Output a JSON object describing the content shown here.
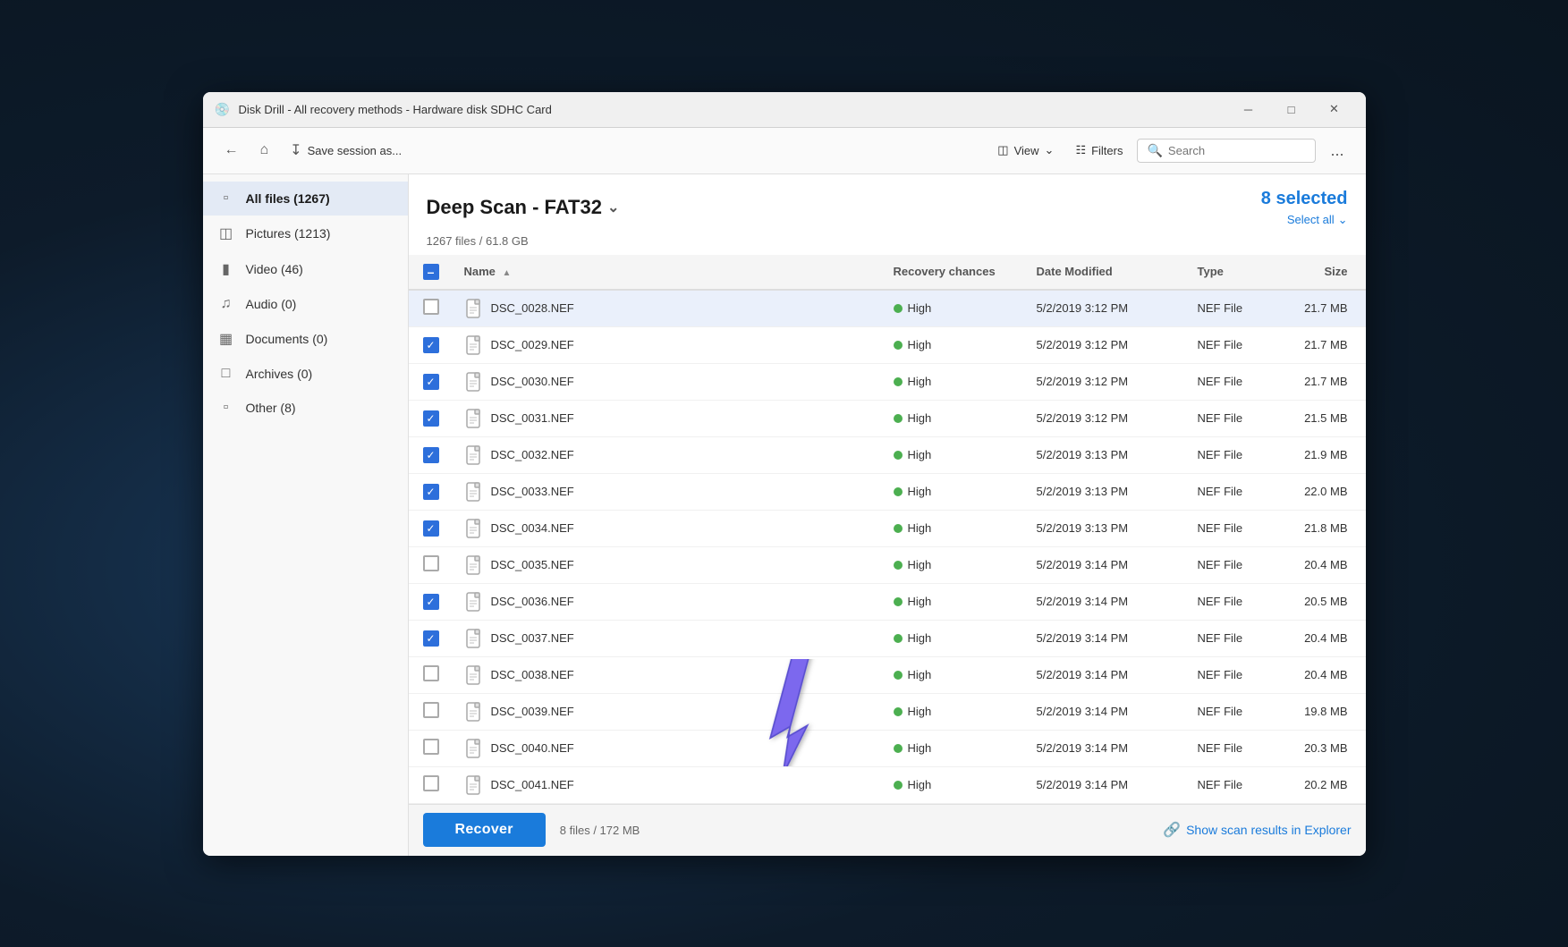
{
  "window": {
    "title": "Disk Drill - All recovery methods - Hardware disk SDHC Card",
    "icon": "💿",
    "controls": {
      "minimize": "─",
      "maximize": "□",
      "close": "✕"
    }
  },
  "toolbar": {
    "back_label": "←",
    "home_label": "⌂",
    "save_label": "💾",
    "save_session_label": "Save session as...",
    "view_label": "View",
    "filters_label": "Filters",
    "search_placeholder": "Search",
    "more_label": "..."
  },
  "sidebar": {
    "items": [
      {
        "id": "all-files",
        "label": "All files (1267)",
        "icon": "▭",
        "active": true
      },
      {
        "id": "pictures",
        "label": "Pictures (1213)",
        "icon": "🖼"
      },
      {
        "id": "video",
        "label": "Video (46)",
        "icon": "🎞"
      },
      {
        "id": "audio",
        "label": "Audio (0)",
        "icon": "♪"
      },
      {
        "id": "documents",
        "label": "Documents (0)",
        "icon": "📄"
      },
      {
        "id": "archives",
        "label": "Archives (0)",
        "icon": "▣"
      },
      {
        "id": "other",
        "label": "Other (8)",
        "icon": "▭"
      }
    ]
  },
  "content": {
    "scan_title": "Deep Scan - FAT32",
    "file_count": "1267 files / 61.8 GB",
    "selected_count": "8 selected",
    "select_all_label": "Select all",
    "columns": {
      "name": "Name",
      "recovery_chances": "Recovery chances",
      "date_modified": "Date Modified",
      "type": "Type",
      "size": "Size"
    },
    "files": [
      {
        "name": "DSC_0028.NEF",
        "checked": false,
        "highlighted": true,
        "recovery": "High",
        "date": "5/2/2019 3:12 PM",
        "type": "NEF File",
        "size": "21.7 MB"
      },
      {
        "name": "DSC_0029.NEF",
        "checked": true,
        "highlighted": false,
        "recovery": "High",
        "date": "5/2/2019 3:12 PM",
        "type": "NEF File",
        "size": "21.7 MB"
      },
      {
        "name": "DSC_0030.NEF",
        "checked": true,
        "highlighted": false,
        "recovery": "High",
        "date": "5/2/2019 3:12 PM",
        "type": "NEF File",
        "size": "21.7 MB"
      },
      {
        "name": "DSC_0031.NEF",
        "checked": true,
        "highlighted": false,
        "recovery": "High",
        "date": "5/2/2019 3:12 PM",
        "type": "NEF File",
        "size": "21.5 MB"
      },
      {
        "name": "DSC_0032.NEF",
        "checked": true,
        "highlighted": false,
        "recovery": "High",
        "date": "5/2/2019 3:13 PM",
        "type": "NEF File",
        "size": "21.9 MB"
      },
      {
        "name": "DSC_0033.NEF",
        "checked": true,
        "highlighted": false,
        "recovery": "High",
        "date": "5/2/2019 3:13 PM",
        "type": "NEF File",
        "size": "22.0 MB"
      },
      {
        "name": "DSC_0034.NEF",
        "checked": true,
        "highlighted": false,
        "recovery": "High",
        "date": "5/2/2019 3:13 PM",
        "type": "NEF File",
        "size": "21.8 MB"
      },
      {
        "name": "DSC_0035.NEF",
        "checked": false,
        "highlighted": false,
        "recovery": "High",
        "date": "5/2/2019 3:14 PM",
        "type": "NEF File",
        "size": "20.4 MB"
      },
      {
        "name": "DSC_0036.NEF",
        "checked": true,
        "highlighted": false,
        "recovery": "High",
        "date": "5/2/2019 3:14 PM",
        "type": "NEF File",
        "size": "20.5 MB"
      },
      {
        "name": "DSC_0037.NEF",
        "checked": true,
        "highlighted": false,
        "recovery": "High",
        "date": "5/2/2019 3:14 PM",
        "type": "NEF File",
        "size": "20.4 MB"
      },
      {
        "name": "DSC_0038.NEF",
        "checked": false,
        "highlighted": false,
        "recovery": "High",
        "date": "5/2/2019 3:14 PM",
        "type": "NEF File",
        "size": "20.4 MB"
      },
      {
        "name": "DSC_0039.NEF",
        "checked": false,
        "highlighted": false,
        "recovery": "High",
        "date": "5/2/2019 3:14 PM",
        "type": "NEF File",
        "size": "19.8 MB"
      },
      {
        "name": "DSC_0040.NEF",
        "checked": false,
        "highlighted": false,
        "recovery": "High",
        "date": "5/2/2019 3:14 PM",
        "type": "NEF File",
        "size": "20.3 MB"
      },
      {
        "name": "DSC_0041.NEF",
        "checked": false,
        "highlighted": false,
        "recovery": "High",
        "date": "5/2/2019 3:14 PM",
        "type": "NEF File",
        "size": "20.2 MB"
      }
    ]
  },
  "bottom_bar": {
    "recover_label": "Recover",
    "selected_info": "8 files / 172 MB",
    "show_results_label": "Show scan results in Explorer",
    "show_results_icon": "↗"
  }
}
